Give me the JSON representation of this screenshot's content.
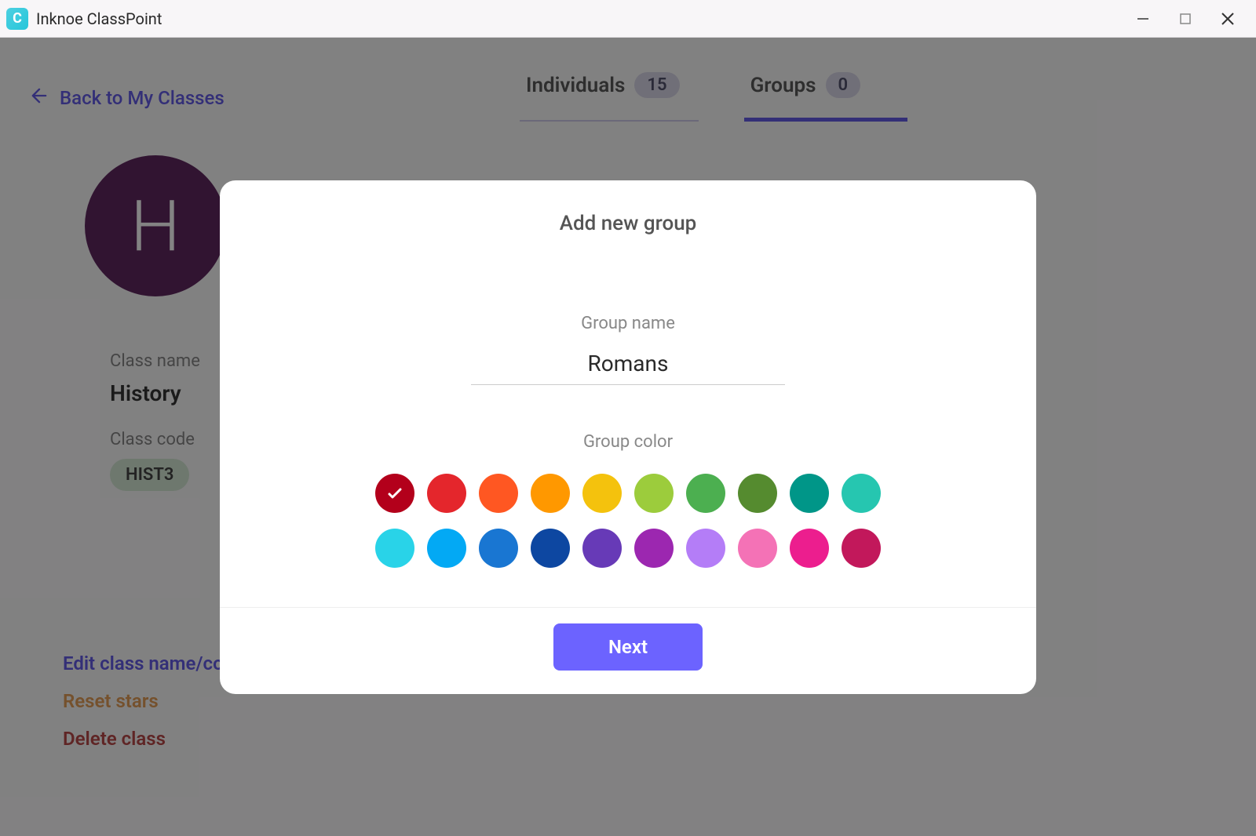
{
  "window": {
    "title": "Inknoe ClassPoint",
    "app_icon_letter": "C"
  },
  "sidebar": {
    "back_label": "Back to My Classes",
    "avatar_letter": "H",
    "class_name_label": "Class name",
    "class_name_value": "History",
    "class_code_label": "Class code",
    "class_code_value": "HIST3",
    "actions": {
      "edit": "Edit class name/code",
      "reset": "Reset stars",
      "delete": "Delete class"
    }
  },
  "tabs": {
    "individuals": {
      "label": "Individuals",
      "count": "15"
    },
    "groups": {
      "label": "Groups",
      "count": "0"
    }
  },
  "modal": {
    "title": "Add new group",
    "group_name_label": "Group name",
    "group_name_value": "Romans",
    "group_color_label": "Group color",
    "next_label": "Next",
    "colors_row1": [
      {
        "hex": "#b3001b",
        "selected": true
      },
      {
        "hex": "#e4262c",
        "selected": false
      },
      {
        "hex": "#ff5722",
        "selected": false
      },
      {
        "hex": "#ff9800",
        "selected": false
      },
      {
        "hex": "#f4c20d",
        "selected": false
      },
      {
        "hex": "#9ccc3c",
        "selected": false
      },
      {
        "hex": "#4caf50",
        "selected": false
      },
      {
        "hex": "#558b2f",
        "selected": false
      },
      {
        "hex": "#009688",
        "selected": false
      },
      {
        "hex": "#26c6b0",
        "selected": false
      }
    ],
    "colors_row2": [
      {
        "hex": "#29d3e8",
        "selected": false
      },
      {
        "hex": "#03a9f4",
        "selected": false
      },
      {
        "hex": "#1976d2",
        "selected": false
      },
      {
        "hex": "#0d47a1",
        "selected": false
      },
      {
        "hex": "#673ab7",
        "selected": false
      },
      {
        "hex": "#9c27b0",
        "selected": false
      },
      {
        "hex": "#b47df7",
        "selected": false
      },
      {
        "hex": "#f472b6",
        "selected": false
      },
      {
        "hex": "#ec1e8e",
        "selected": false
      },
      {
        "hex": "#c2185b",
        "selected": false
      }
    ]
  }
}
